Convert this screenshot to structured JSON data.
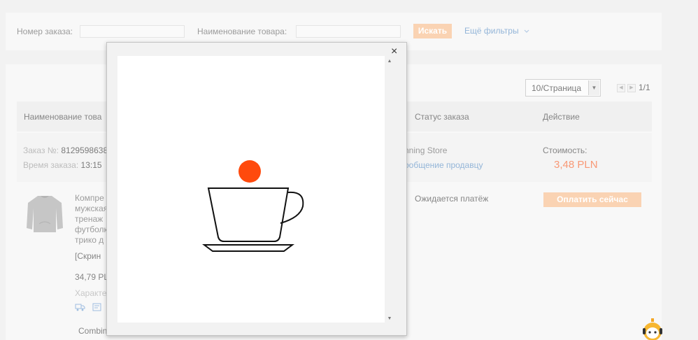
{
  "filters": {
    "order_number_label": "Номер заказа:",
    "product_name_label": "Наименование товара:",
    "search_button": "Искать",
    "more_filters": "Ещё фильтры"
  },
  "pagination": {
    "page_size": "10/Страница",
    "page_count": "1/1"
  },
  "table": {
    "headers": {
      "product": "Наименование това",
      "status": "Статус заказа",
      "action": "Действие"
    }
  },
  "order": {
    "number_label": "Заказ №:",
    "number_value": "8129598638",
    "time_label": "Время заказа:",
    "time_value": "13:15",
    "store_name": "nning Store",
    "message_seller": "ообщение продавцу",
    "cost_label": "Стоимость:",
    "cost_value": "3,48 PLN",
    "status": "Ожидается платёж",
    "pay_button": "Оплатить сейчас",
    "product_lines": [
      "Компре",
      "мужская",
      "тренаж",
      "футболк",
      "трико д"
    ],
    "product_extra": "[Скрин",
    "product_price": "34,79 PL",
    "characteristics": "Характе",
    "combine_label": "Combin"
  },
  "modal": {
    "close_symbol": "×"
  },
  "colors": {
    "accent_orange": "#f7bc8a",
    "price_red": "#f5622c",
    "link_blue": "#5a8ec4",
    "loader_dot": "#ff4a0d"
  },
  "icons": {
    "close": "close-icon",
    "cup": "coffee-cup-loader-icon",
    "chevron": "chevron-down-icon",
    "assistant": "assistant-bot-icon"
  }
}
